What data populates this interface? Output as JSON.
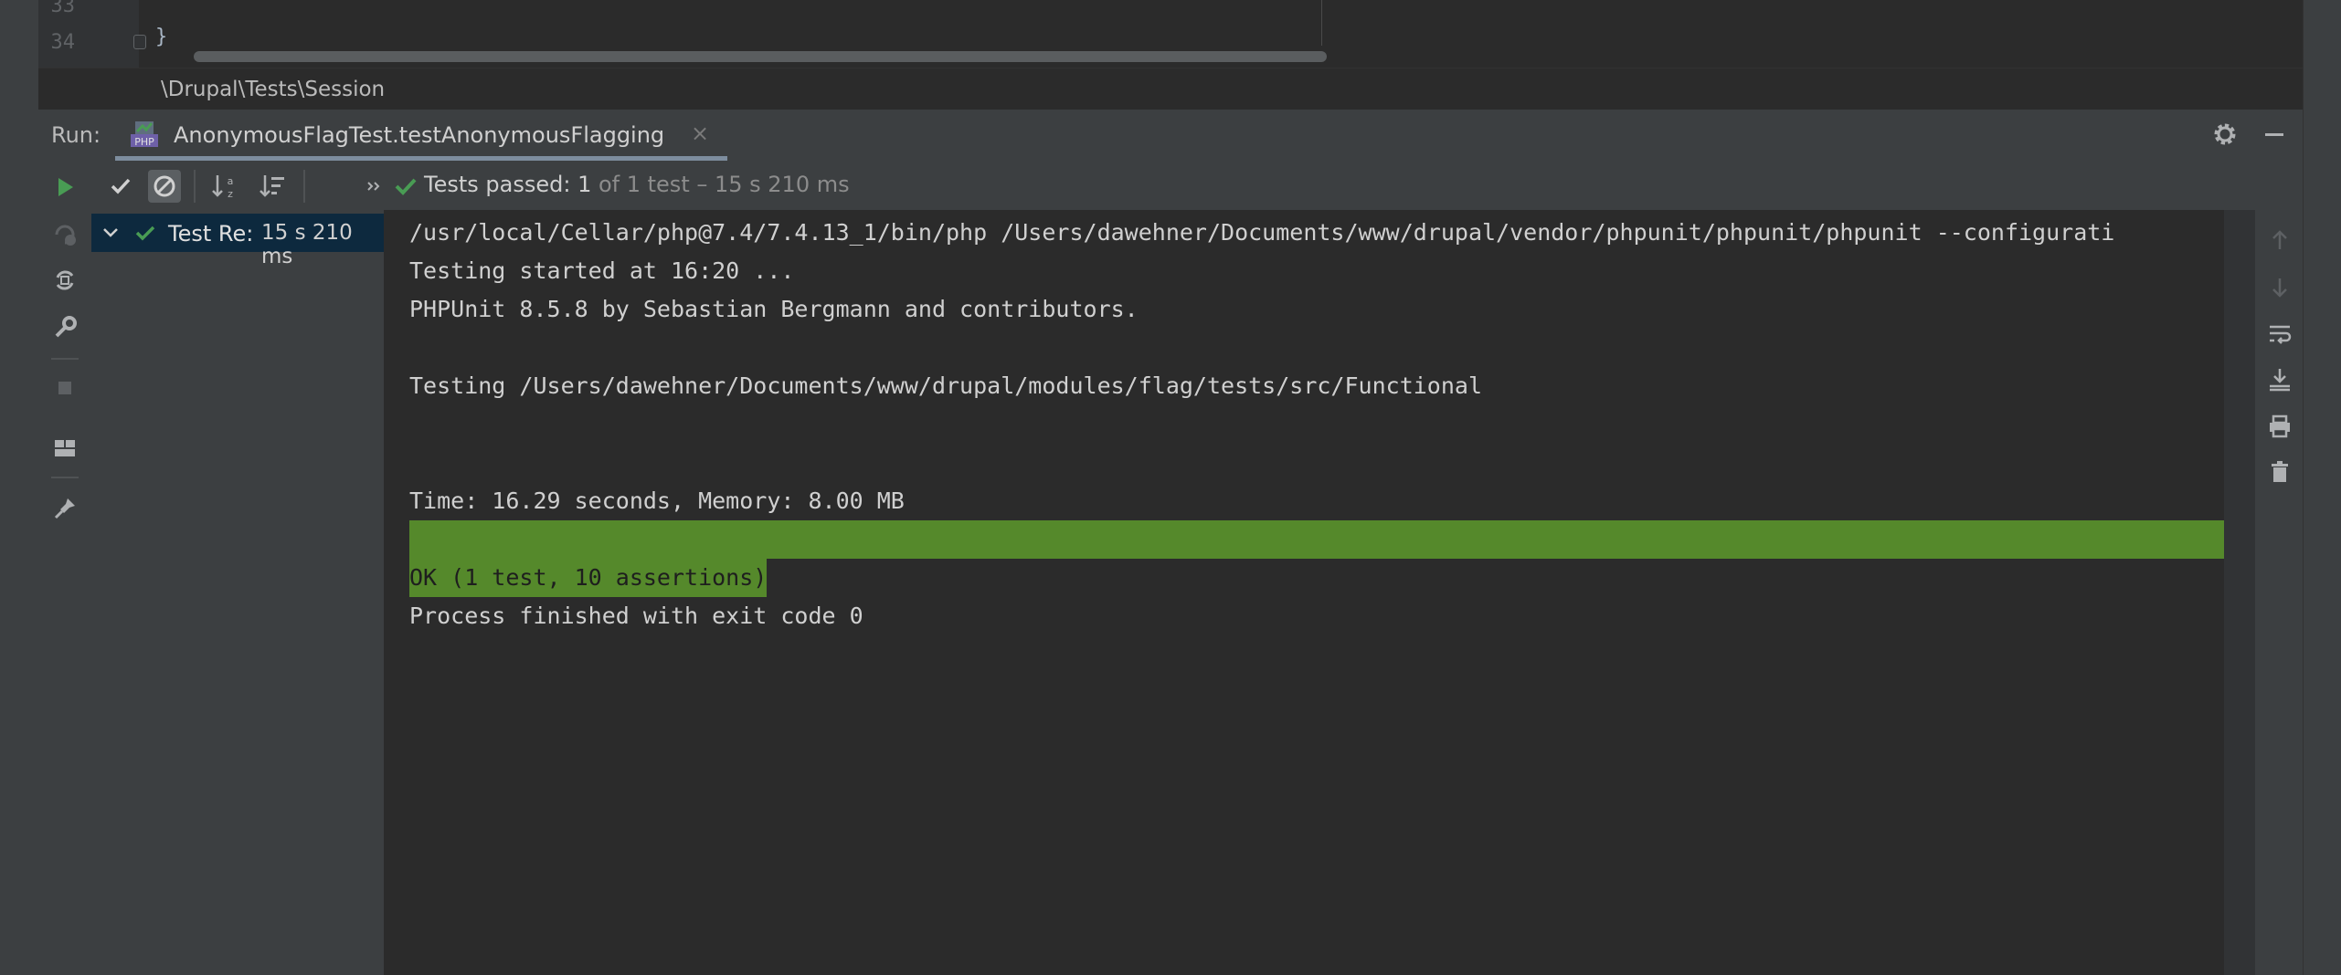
{
  "editor": {
    "line_numbers": [
      "33",
      "34"
    ],
    "code_last": "}"
  },
  "breadcrumb": "\\Drupal\\Tests\\Session",
  "run": {
    "label": "Run:",
    "tab_title": "AnonymousFlagTest.testAnonymousFlagging",
    "tab_icon_text": "PHP",
    "tab_close": "×"
  },
  "status": {
    "passed_prefix": "Tests passed: ",
    "passed_count": "1",
    "rest": " of 1 test – 15 s 210 ms"
  },
  "tree": {
    "label": "Test Re:",
    "time": "15 s 210 ms"
  },
  "console": {
    "lines": [
      "/usr/local/Cellar/php@7.4/7.4.13_1/bin/php /Users/dawehner/Documents/www/drupal/vendor/phpunit/phpunit/phpunit --configurati",
      "Testing started at 16:20 ...",
      "PHPUnit 8.5.8 by Sebastian Bergmann and contributors.",
      "",
      "Testing /Users/dawehner/Documents/www/drupal/modules/flag/tests/src/Functional",
      "",
      "",
      "Time: 16.29 seconds, Memory: 8.00 MB",
      "",
      "OK (1 test, 10 assertions)",
      "Process finished with exit code 0"
    ]
  },
  "colors": {
    "pass_green": "#499c54",
    "bar_green": "#55892b",
    "selection": "#0d293e"
  }
}
